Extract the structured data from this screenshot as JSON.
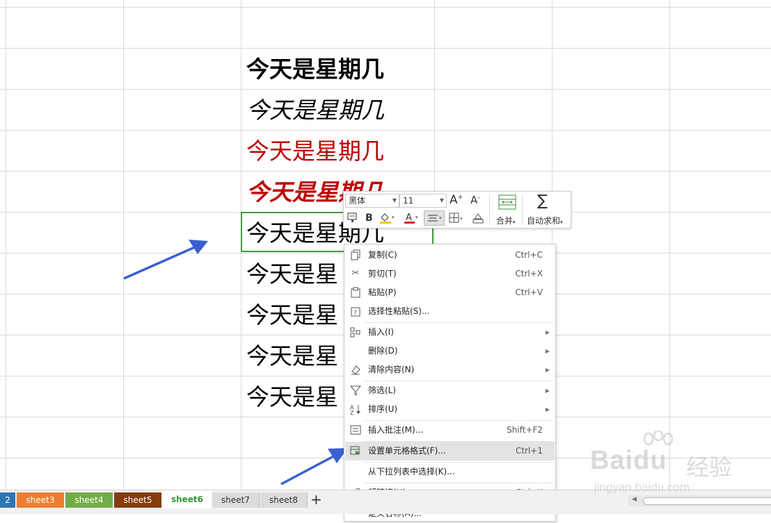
{
  "cells": [
    {
      "text": "今天是星期几",
      "style": "bold"
    },
    {
      "text": "今天是星期几",
      "style": "italic"
    },
    {
      "text": "今天是星期几",
      "style": "red"
    },
    {
      "text": "今天是星期几",
      "style": "bold-italic-red"
    },
    {
      "text": "今天是星期几",
      "style": "normal-selected"
    },
    {
      "text": "今天是星",
      "style": "normal"
    },
    {
      "text": "今天是星",
      "style": "normal"
    },
    {
      "text": "今天是星",
      "style": "normal"
    },
    {
      "text": "今天是星",
      "style": "normal"
    }
  ],
  "mini_toolbar": {
    "font_name": "黑体",
    "font_size": "11",
    "grow_font": "A",
    "shrink_font": "A",
    "bold": "B",
    "merge_label": "合并",
    "autosum_label": "自动求和"
  },
  "context_menu": {
    "items": [
      {
        "label": "复制(C)",
        "shortcut": "Ctrl+C",
        "icon": "copy-icon"
      },
      {
        "label": "剪切(T)",
        "shortcut": "Ctrl+X",
        "icon": "cut-icon"
      },
      {
        "label": "粘贴(P)",
        "shortcut": "Ctrl+V",
        "icon": "paste-icon"
      },
      {
        "label": "选择性粘贴(S)...",
        "shortcut": "",
        "icon": "paste-special-icon"
      },
      {
        "label": "插入(I)",
        "shortcut": "",
        "icon": "insert-icon",
        "submenu": true
      },
      {
        "label": "删除(D)",
        "shortcut": "",
        "icon": "",
        "submenu": true
      },
      {
        "label": "清除内容(N)",
        "shortcut": "",
        "icon": "eraser-icon",
        "submenu": true
      },
      {
        "label": "筛选(L)",
        "shortcut": "",
        "icon": "filter-icon",
        "submenu": true
      },
      {
        "label": "排序(U)",
        "shortcut": "",
        "icon": "sort-icon",
        "submenu": true
      },
      {
        "label": "插入批注(M)...",
        "shortcut": "Shift+F2",
        "icon": "comment-icon"
      },
      {
        "label": "设置单元格格式(F)...",
        "shortcut": "Ctrl+1",
        "icon": "format-cells-icon",
        "highlighted": true
      },
      {
        "label": "从下拉列表中选择(K)...",
        "shortcut": "",
        "icon": ""
      },
      {
        "label": "超链接(H)...",
        "shortcut": "Ctrl+K",
        "icon": "link-icon"
      },
      {
        "label": "定义名称(A)...",
        "shortcut": "",
        "icon": ""
      }
    ]
  },
  "sheet_tabs": [
    {
      "label": "2",
      "color": "#2e75b6"
    },
    {
      "label": "sheet3",
      "color": "#ed7d31"
    },
    {
      "label": "sheet4",
      "color": "#70ad47"
    },
    {
      "label": "sheet5",
      "color": "#843c0c"
    },
    {
      "label": "sheet6",
      "color": "#ffffff",
      "active": true
    },
    {
      "label": "sheet7",
      "color": "#dcdcdc"
    },
    {
      "label": "sheet8",
      "color": "#dcdcdc"
    }
  ],
  "add_sheet": "+",
  "watermark": {
    "logo": "Baidu",
    "cn": "经验",
    "url": "jingyan.baidu.com"
  }
}
